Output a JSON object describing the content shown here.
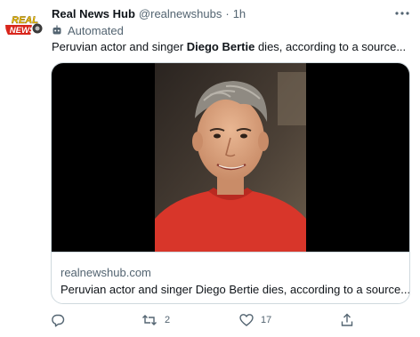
{
  "tweet": {
    "author_name": "Real News Hub",
    "handle": "@realnewshubs",
    "separator": "·",
    "time": "1h",
    "automated_label": "Automated",
    "text_before": "Peruvian actor and singer ",
    "text_bold": "Diego Bertie",
    "text_after": " dies, according to a source..."
  },
  "avatar": {
    "logo_line1": "REAL",
    "logo_line2": "NEWS"
  },
  "card": {
    "domain": "realnewshub.com",
    "title": "Peruvian actor and singer Diego Bertie dies, according to a source..."
  },
  "actions": {
    "reply_count": "",
    "retweet_count": "2",
    "like_count": "17"
  },
  "icons": {
    "more": "more-dots-icon",
    "automated": "robot-icon",
    "reply": "reply-icon",
    "retweet": "retweet-icon",
    "like": "heart-icon",
    "share": "share-icon"
  },
  "colors": {
    "text": "#0f1419",
    "muted": "#536471",
    "border": "#cfd9de",
    "logo_yellow": "#f5c400",
    "logo_red": "#d9261c"
  }
}
